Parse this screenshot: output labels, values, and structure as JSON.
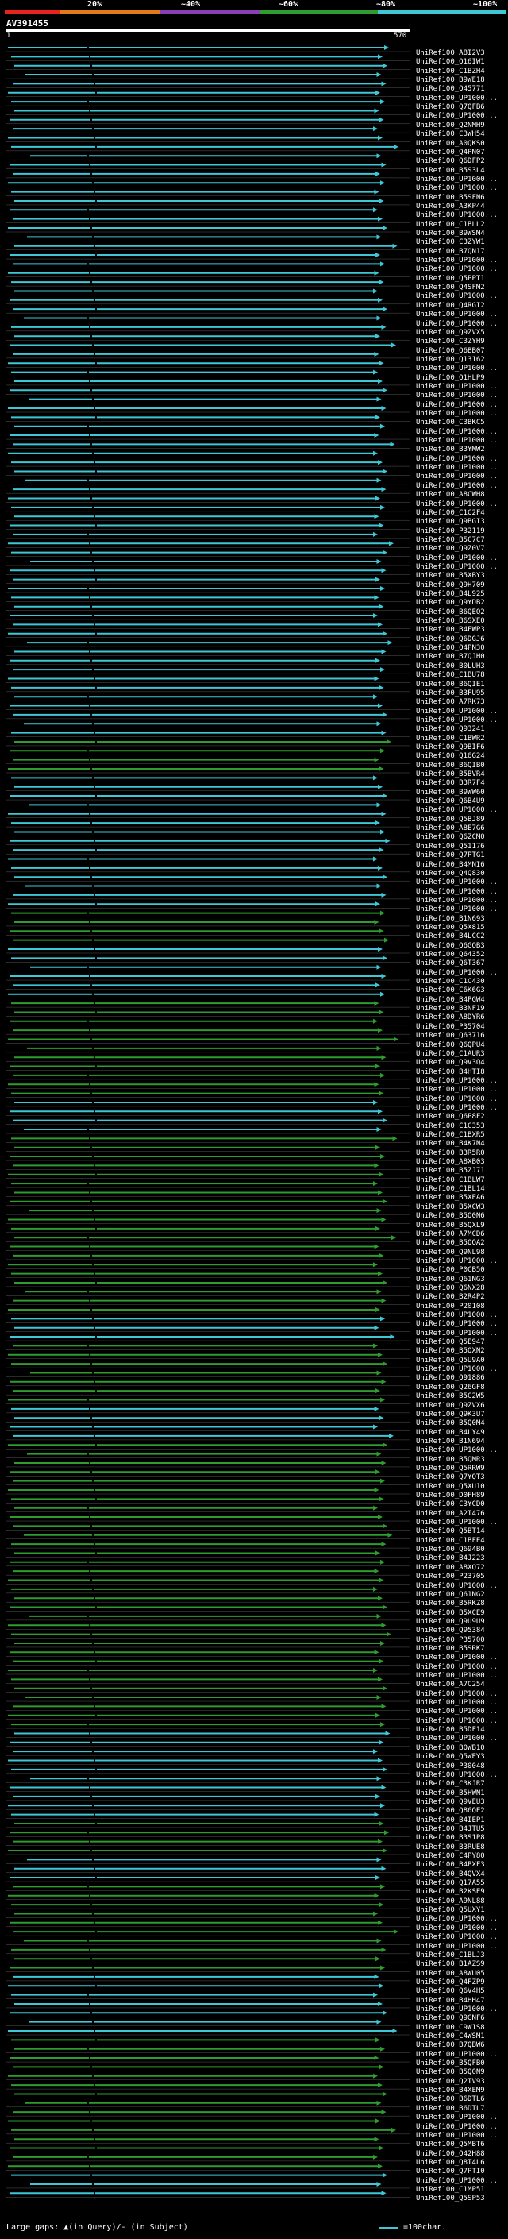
{
  "scale": {
    "labels": [
      "20%",
      "~40%",
      "~60%",
      "~80%",
      "~100%"
    ],
    "colors": [
      "#e8231f",
      "#e07b18",
      "#8a3fb2",
      "#2e9c2e",
      "#3ec7d6"
    ]
  },
  "query": {
    "id": "AV391455",
    "start": "1",
    "end": "570"
  },
  "colors": {
    "cyan": "#3ec7d6",
    "green": "#2e9c2e",
    "background": "#000000",
    "divider": "#555555"
  },
  "hits": [
    "UniRef100_A8I2V3",
    "UniRef100_Q16IW1",
    "UniRef100_C1BZH4",
    "UniRef100_B9WE18",
    "UniRef100_Q45771",
    "UniRef100_UP1000...",
    "UniRef100_Q7QFB6",
    "UniRef100_UP1000...",
    "UniRef100_Q2NMH9",
    "UniRef100_C3WH54",
    "UniRef100_A0QKS0",
    "UniRef100_Q4PN07",
    "UniRef100_Q6DFP2",
    "UniRef100_B5S3L4",
    "UniRef100_UP1000...",
    "UniRef100_UP1000...",
    "UniRef100_B5SFN6",
    "UniRef100_A3KP44",
    "UniRef100_UP1000...",
    "UniRef100_C1BLL2",
    "UniRef100_B9WSM4",
    "UniRef100_C3ZYW1",
    "UniRef100_B7QN17",
    "UniRef100_UP1000...",
    "UniRef100_UP1000...",
    "UniRef100_Q5PPT1",
    "UniRef100_Q4SFM2",
    "UniRef100_UP1000...",
    "UniRef100_Q4RGI2",
    "UniRef100_UP1000...",
    "UniRef100_UP1000...",
    "UniRef100_Q9ZVX5",
    "UniRef100_C3ZYH9",
    "UniRef100_Q6BB07",
    "UniRef100_Q13162",
    "UniRef100_UP1000...",
    "UniRef100_Q1HLP9",
    "UniRef100_UP1000...",
    "UniRef100_UP1000...",
    "UniRef100_UP1000...",
    "UniRef100_UP1000...",
    "UniRef100_C3BKC5",
    "UniRef100_UP1000...",
    "UniRef100_UP1000...",
    "UniRef100_B3YMW2",
    "UniRef100_UP1000...",
    "UniRef100_UP1000...",
    "UniRef100_UP1000...",
    "UniRef100_UP1000...",
    "UniRef100_A8CWH8",
    "UniRef100_UP1000...",
    "UniRef100_C1C2F4",
    "UniRef100_Q9BGI3",
    "UniRef100_P32119",
    "UniRef100_B5C7C7",
    "UniRef100_Q9Z0V7",
    "UniRef100_UP1000...",
    "UniRef100_UP1000...",
    "UniRef100_B5XBY3",
    "UniRef100_Q9H709",
    "UniRef100_B4L925",
    "UniRef100_Q9YDB2",
    "UniRef100_B6QEQ2",
    "UniRef100_B6SXE0",
    "UniRef100_B4FWP3",
    "UniRef100_Q6DGJ6",
    "UniRef100_Q4PN30",
    "UniRef100_B7QJH0",
    "UniRef100_B0LUH3",
    "UniRef100_C1BU78",
    "UniRef100_B6QIE1",
    "UniRef100_B3FU95",
    "UniRef100_A7RK73",
    "UniRef100_UP1000...",
    "UniRef100_UP1000...",
    "UniRef100_Q93241",
    "UniRef100_C1BWR2",
    "UniRef100_Q9BIF6",
    "UniRef100_Q16G24",
    "UniRef100_B6QIB0",
    "UniRef100_B5BVR4",
    "UniRef100_B3R7F4",
    "UniRef100_B9WW60",
    "UniRef100_Q6B4U9",
    "UniRef100_UP1000...",
    "UniRef100_Q5BJ89",
    "UniRef100_A8E7G6",
    "UniRef100_Q6ZCM0",
    "UniRef100_Q51176",
    "UniRef100_Q7PTG1",
    "UniRef100_B4MNI6",
    "UniRef100_Q4Q830",
    "UniRef100_UP1000...",
    "UniRef100_UP1000...",
    "UniRef100_UP1000...",
    "UniRef100_UP1000...",
    "UniRef100_B1N693",
    "UniRef100_Q5X815",
    "UniRef100_B4LCC2",
    "UniRef100_Q6GQB3",
    "UniRef100_Q64352",
    "UniRef100_Q6T367",
    "UniRef100_UP1000...",
    "UniRef100_C1C430",
    "UniRef100_C6K6G3",
    "UniRef100_B4PGW4",
    "UniRef100_B3NF19",
    "UniRef100_A8DYR6",
    "UniRef100_P35704",
    "UniRef100_Q63716",
    "UniRef100_Q6QPU4",
    "UniRef100_C1AUR3",
    "UniRef100_Q9V3Q4",
    "UniRef100_B4HTI8",
    "UniRef100_UP1000...",
    "UniRef100_UP1000...",
    "UniRef100_UP1000...",
    "UniRef100_UP1000...",
    "UniRef100_Q6P8F2",
    "UniRef100_C1C353",
    "UniRef100_C1BXR5",
    "UniRef100_B4K7N4",
    "UniRef100_B3R5R0",
    "UniRef100_A8XB03",
    "UniRef100_B5ZJ71",
    "UniRef100_C1BLW7",
    "UniRef100_C1BL14",
    "UniRef100_B5XEA6",
    "UniRef100_B5XCW3",
    "UniRef100_B5Q0N6",
    "UniRef100_B5QXL9",
    "UniRef100_A7MCD6",
    "UniRef100_B5QQA2",
    "UniRef100_Q9NL98",
    "UniRef100_UP1000...",
    "UniRef100_P0CB50",
    "UniRef100_Q61NG3",
    "UniRef100_Q6NX28",
    "UniRef100_B2R4P2",
    "UniRef100_P20108",
    "UniRef100_UP1000...",
    "UniRef100_UP1000...",
    "UniRef100_UP1000...",
    "UniRef100_Q5E947",
    "UniRef100_B5QXN2",
    "UniRef100_Q5U9A0",
    "UniRef100_UP1000...",
    "UniRef100_Q91886",
    "UniRef100_Q26GF8",
    "UniRef100_B5C2W5",
    "UniRef100_Q9ZVX6",
    "UniRef100_Q9K3U7",
    "UniRef100_B5Q0M4",
    "UniRef100_B4LY49",
    "UniRef100_B1N694",
    "UniRef100_UP1000...",
    "UniRef100_B5QMR3",
    "UniRef100_Q5RRW9",
    "UniRef100_Q7YQT3",
    "UniRef100_Q5XU10",
    "UniRef100_D0FH89",
    "UniRef100_C3YCD0",
    "UniRef100_A2I476",
    "UniRef100_UP1000...",
    "UniRef100_Q5BT14",
    "UniRef100_C1BFE4",
    "UniRef100_Q694B0",
    "UniRef100_B4J223",
    "UniRef100_A8XQ72",
    "UniRef100_P23705",
    "UniRef100_UP1000...",
    "UniRef100_Q61NG2",
    "UniRef100_B5RKZ8",
    "UniRef100_B5XCE9",
    "UniRef100_Q9U9U9",
    "UniRef100_Q95384",
    "UniRef100_P35700",
    "UniRef100_B5SRK7",
    "UniRef100_UP1000...",
    "UniRef100_UP1000...",
    "UniRef100_UP1000...",
    "UniRef100_A7C254",
    "UniRef100_UP1000...",
    "UniRef100_UP1000...",
    "UniRef100_UP1000...",
    "UniRef100_UP1000...",
    "UniRef100_B5DF14",
    "UniRef100_UP1000...",
    "UniRef100_B0WB10",
    "UniRef100_Q5WEY3",
    "UniRef100_P30048",
    "UniRef100_UP1000...",
    "UniRef100_C3KJR7",
    "UniRef100_B5HWN1",
    "UniRef100_Q9VEU3",
    "UniRef100_Q86QE2",
    "UniRef100_B4IEP1",
    "UniRef100_B4JTU5",
    "UniRef100_B3S1P8",
    "UniRef100_B3RUE8",
    "UniRef100_C4PY80",
    "UniRef100_B4PXF3",
    "UniRef100_B4QVX4",
    "UniRef100_Q17A55",
    "UniRef100_B2KSE9",
    "UniRef100_A9NL88",
    "UniRef100_Q5UXY1",
    "UniRef100_UP1000...",
    "UniRef100_UP1000...",
    "UniRef100_UP1000...",
    "UniRef100_UP1000...",
    "UniRef100_C1BLJ3",
    "UniRef100_B1AZS9",
    "UniRef100_A8WU05",
    "UniRef100_Q4FZP9",
    "UniRef100_Q6V4H5",
    "UniRef100_B4HH47",
    "UniRef100_UP1000...",
    "UniRef100_Q9GNF6",
    "UniRef100_C9W1S8",
    "UniRef100_C4WSM1",
    "UniRef100_B7QBW6",
    "UniRef100_UP1000...",
    "UniRef100_B5QFB0",
    "UniRef100_B5Q0N9",
    "UniRef100_Q2TV93",
    "UniRef100_B4XEM9",
    "UniRef100_B6DTL6",
    "UniRef100_B6DTL7",
    "UniRef100_UP1000...",
    "UniRef100_UP1000...",
    "UniRef100_UP1000...",
    "UniRef100_Q5MBT6",
    "UniRef100_Q42H88",
    "UniRef100_Q8T4L6",
    "UniRef100_Q7PTI0",
    "UniRef100_UP1000...",
    "UniRef100_C1MP51",
    "UniRef100_Q5SP53"
  ],
  "legend": {
    "left_text": "Large gaps: ▲(in Query)/- (in Subject)",
    "right_text": "=100char."
  }
}
